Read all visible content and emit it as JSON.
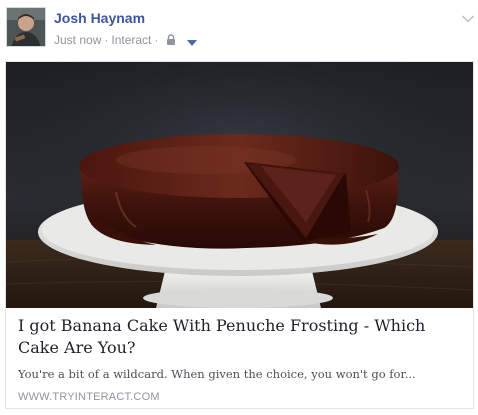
{
  "post": {
    "author": "Josh Haynam",
    "timestamp": "Just now",
    "app": "Interact",
    "separator": "·",
    "privacy_icon": "lock-icon",
    "audience_icon": "caret-down-icon",
    "options_icon": "chevron-down-icon"
  },
  "card": {
    "title": "I got Banana Cake With Penuche Frosting - Which Cake Are You?",
    "description": "You're a bit of a wildcard. When given the choice, you won't go for...",
    "domain": "WWW.TRYINTERACT.COM",
    "image_subject": "chocolate-glazed cake on a white cake stand"
  },
  "colors": {
    "author_link": "#3b5998",
    "meta_text": "#90949c",
    "title_text": "#1d2129",
    "description_text": "#4b4f56"
  }
}
